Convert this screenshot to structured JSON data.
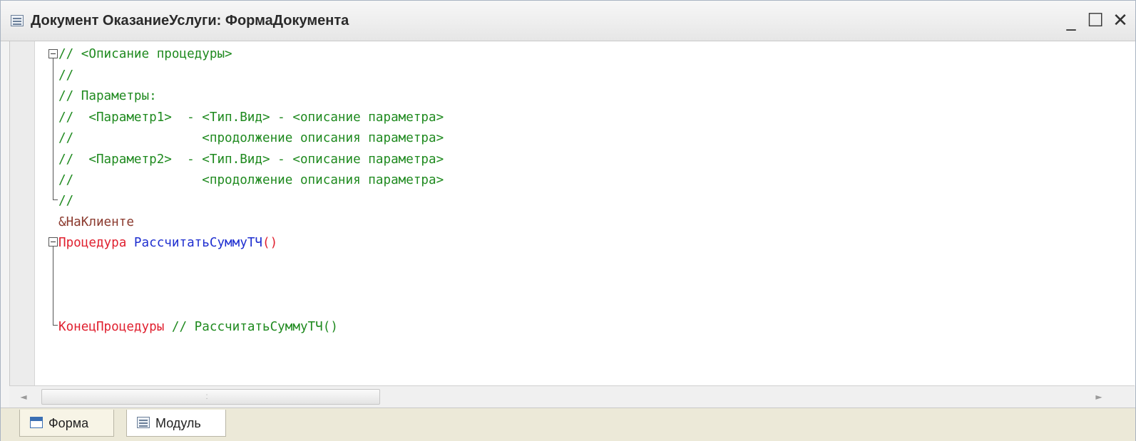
{
  "window": {
    "title": "Документ ОказаниеУслуги: ФормаДокумента",
    "icon": "module-icon",
    "controls": {
      "minimize": "_",
      "maximize": "☐",
      "close": "✕"
    }
  },
  "code": {
    "lines": [
      "// <Описание процедуры>",
      "//",
      "// Параметры:",
      "//  <Параметр1>  - <Тип.Вид> - <описание параметра>",
      "//                 <продолжение описания параметра>",
      "//  <Параметр2>  - <Тип.Вид> - <описание параметра>",
      "//                 <продолжение описания параметра>",
      "//",
      "&НаКлиенте",
      "Процедура",
      " РассчитатьСуммуТЧ",
      "()",
      "КонецПроцедуры",
      " // РассчитатьСуммуТЧ()"
    ]
  },
  "scrollbar": {
    "left_arrow": "◄",
    "right_arrow": "►",
    "grip": "⁚"
  },
  "tabs": [
    {
      "label": "Форма",
      "icon": "form-icon",
      "active": false
    },
    {
      "label": "Модуль",
      "icon": "module-icon",
      "active": true
    }
  ],
  "colors": {
    "comment": "#1f8a1f",
    "directive": "#8b3a2e",
    "keyword": "#e0202f",
    "identifier": "#1f2fd0"
  }
}
